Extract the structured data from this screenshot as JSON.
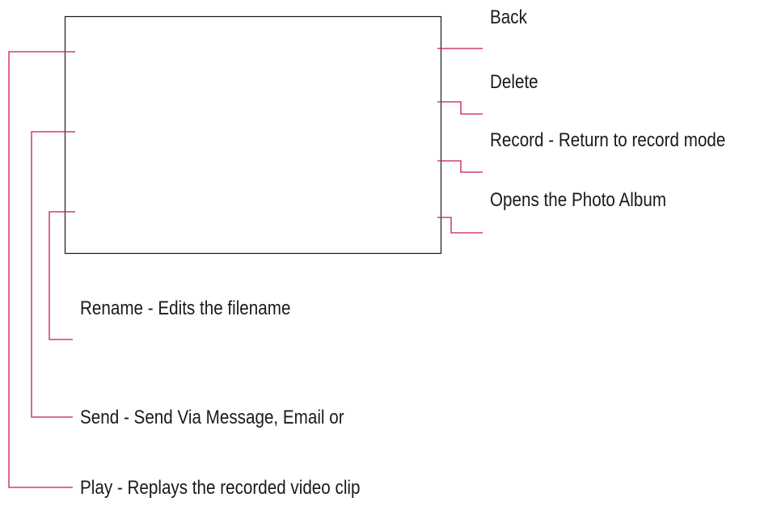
{
  "diagram": {
    "accent_color": "#c8185a",
    "frame_color": "#1a1a1a",
    "right_callouts": {
      "back": "Back",
      "delete": "Delete",
      "record": "Record - Return to record mode",
      "album": "Opens the Photo Album"
    },
    "left_callouts": {
      "rename": "Rename - Edits the filename",
      "send": "Send - Send Via Message, Email or",
      "play": "Play - Replays the recorded video clip"
    }
  }
}
